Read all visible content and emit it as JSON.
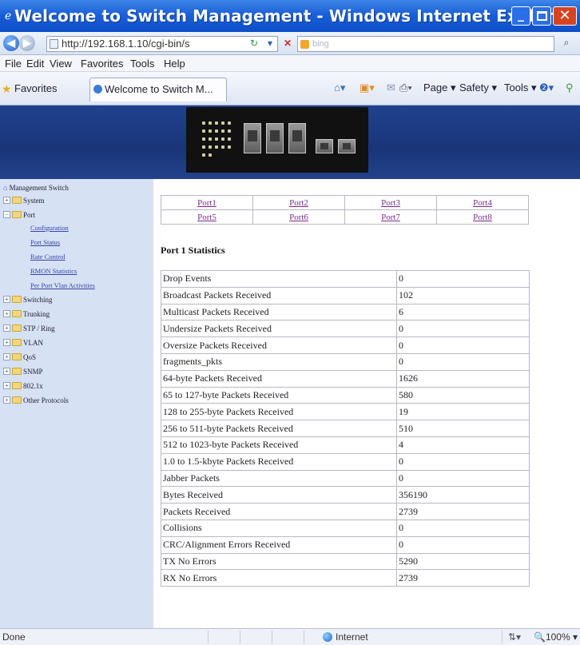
{
  "window": {
    "title": "Welcome to Switch Management - Windows Internet Explorer"
  },
  "addressbar": {
    "url": "http://192.168.1.10/cgi-bin/s",
    "search_placeholder": "bing"
  },
  "menu": [
    "File",
    "Edit",
    "View",
    "Favorites",
    "Tools",
    "Help"
  ],
  "favbar": {
    "favorites_label": "Favorites",
    "tab_title": "Welcome to Switch M...",
    "page_label": "Page",
    "safety_label": "Safety",
    "tools_label": "Tools"
  },
  "sidebar": {
    "root": "Management Switch",
    "system": "System",
    "port": "Port",
    "port_children": [
      "Configuration",
      "Port Status",
      "Rate Control",
      "RMON Statistics",
      "Per Port Vlan Activities"
    ],
    "items": [
      "Switching",
      "Trunking",
      "STP / Ring",
      "VLAN",
      "QoS",
      "SNMP",
      "802.1x",
      "Other Protocols"
    ]
  },
  "ports": {
    "row1": [
      "Port1",
      "Port2",
      "Port3",
      "Port4"
    ],
    "row2": [
      "Port5",
      "Port6",
      "Port7",
      "Port8"
    ]
  },
  "stats": {
    "heading": "Port 1 Statistics",
    "rows": [
      {
        "name": "Drop Events",
        "value": "0"
      },
      {
        "name": "Broadcast Packets Received",
        "value": "102"
      },
      {
        "name": "Multicast Packets Received",
        "value": "6"
      },
      {
        "name": "Undersize Packets Received",
        "value": "0"
      },
      {
        "name": "Oversize Packets Received",
        "value": "0"
      },
      {
        "name": "fragments_pkts",
        "value": "0"
      },
      {
        "name": "64-byte Packets Received",
        "value": "1626"
      },
      {
        "name": "65 to 127-byte Packets Received",
        "value": "580"
      },
      {
        "name": "128 to 255-byte Packets Received",
        "value": "19"
      },
      {
        "name": "256 to 511-byte Packets Received",
        "value": "510"
      },
      {
        "name": "512 to 1023-byte Packets Received",
        "value": "4"
      },
      {
        "name": "1.0 to 1.5-kbyte Packets Received",
        "value": "0"
      },
      {
        "name": "Jabber Packets",
        "value": "0"
      },
      {
        "name": "Bytes Received",
        "value": "356190"
      },
      {
        "name": "Packets Received",
        "value": "2739"
      },
      {
        "name": "Collisions",
        "value": "0"
      },
      {
        "name": "CRC/Alignment Errors Received",
        "value": "0"
      },
      {
        "name": "TX No Errors",
        "value": "5290"
      },
      {
        "name": "RX No Errors",
        "value": "2739"
      }
    ]
  },
  "statusbar": {
    "status": "Done",
    "zone": "Internet",
    "zoom": "100%"
  }
}
